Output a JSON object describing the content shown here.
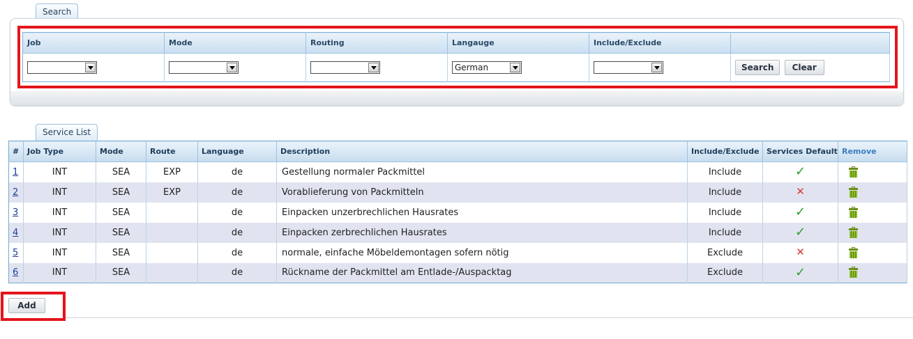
{
  "search": {
    "tab_label": "Search",
    "columns": [
      "Job",
      "Mode",
      "Routing",
      "Langauge",
      "Include/Exclude",
      ""
    ],
    "values": {
      "job": "",
      "mode": "",
      "routing": "",
      "language": "German",
      "include_exclude": ""
    },
    "search_label": "Search",
    "clear_label": "Clear"
  },
  "service_list": {
    "tab_label": "Service List",
    "columns": [
      "#",
      "Job Type",
      "Mode",
      "Route",
      "Language",
      "Description",
      "Include/Exclude",
      "Services Default",
      "Remove"
    ],
    "rows": [
      {
        "num": "1",
        "job_type": "INT",
        "mode": "SEA",
        "route": "EXP",
        "language": "de",
        "description": "Gestellung normaler Packmittel",
        "include_exclude": "Include",
        "services_default": true
      },
      {
        "num": "2",
        "job_type": "INT",
        "mode": "SEA",
        "route": "EXP",
        "language": "de",
        "description": "Vorablieferung von Packmitteln",
        "include_exclude": "Include",
        "services_default": false
      },
      {
        "num": "3",
        "job_type": "INT",
        "mode": "SEA",
        "route": "",
        "language": "de",
        "description": "Einpacken unzerbrechlichen Hausrates",
        "include_exclude": "Include",
        "services_default": true
      },
      {
        "num": "4",
        "job_type": "INT",
        "mode": "SEA",
        "route": "",
        "language": "de",
        "description": "Einpacken zerbrechlichen Hausrates",
        "include_exclude": "Include",
        "services_default": true
      },
      {
        "num": "5",
        "job_type": "INT",
        "mode": "SEA",
        "route": "",
        "language": "de",
        "description": "normale, einfache Möbeldemontagen sofern nötig",
        "include_exclude": "Exclude",
        "services_default": false
      },
      {
        "num": "6",
        "job_type": "INT",
        "mode": "SEA",
        "route": "",
        "language": "de",
        "description": "Rückname der Packmittel am Entlade-/Auspacktag",
        "include_exclude": "Exclude",
        "services_default": true
      }
    ],
    "check_glyph": "✓",
    "cross_glyph": "✕"
  },
  "actions": {
    "add_label": "Add"
  },
  "icons": {
    "remove": "trash-icon",
    "default_yes": "checkmark-icon",
    "default_no": "cross-icon",
    "dropdown": "chevron-down-icon"
  },
  "colors": {
    "highlight": "#e3151b",
    "check": "#2aa02a",
    "cross": "#d73a33",
    "trash": "#7aa51e",
    "header_bg": "#c9def0",
    "row_alt": "#e1e4f0"
  }
}
